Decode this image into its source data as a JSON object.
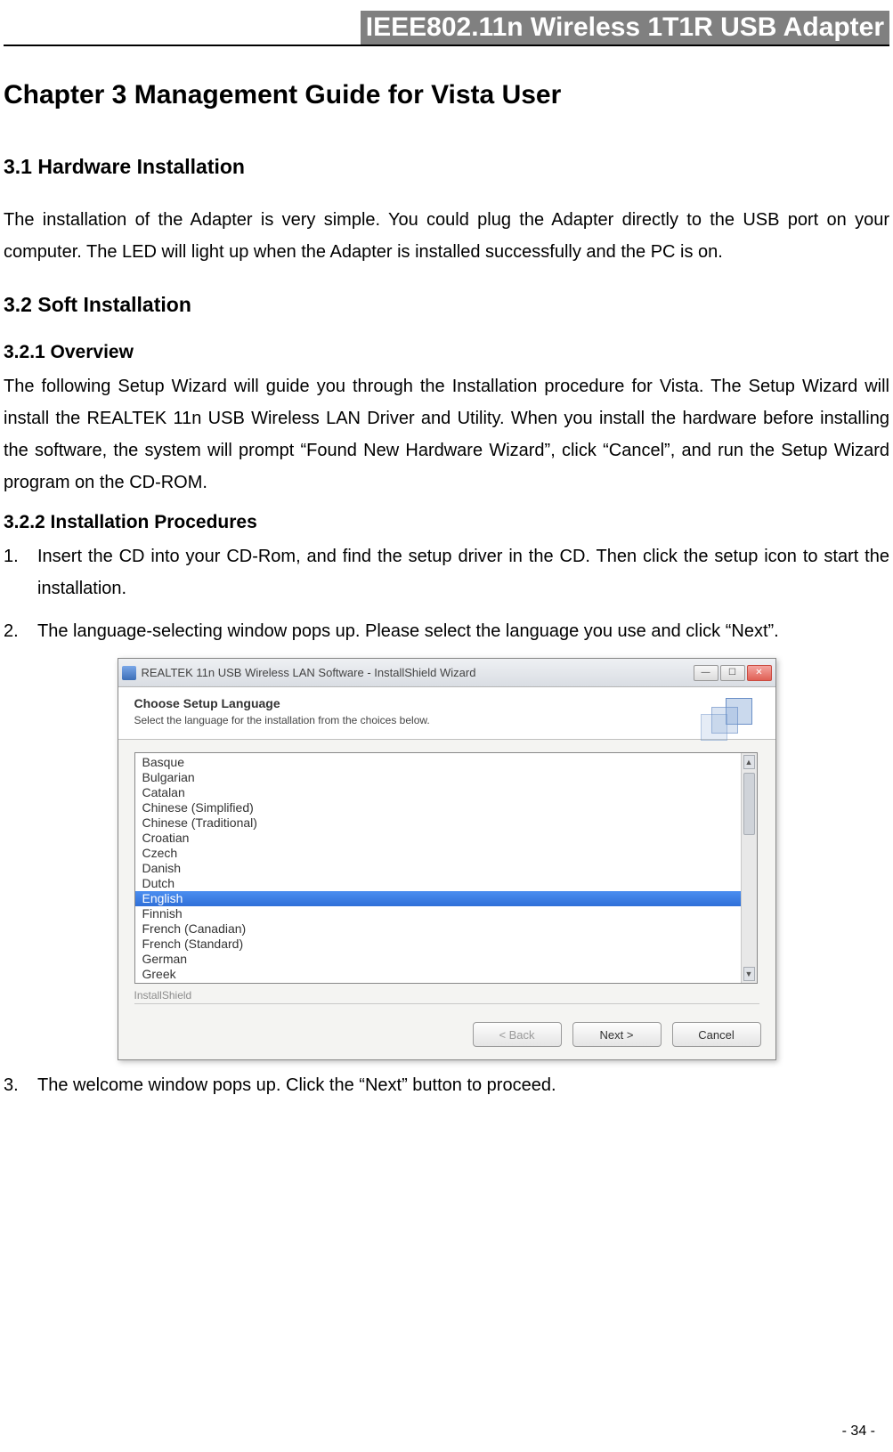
{
  "header_title": "IEEE802.11n Wireless 1T1R USB Adapter",
  "chapter_title": "Chapter 3   Management Guide for Vista User",
  "section_3_1_title": "3.1    Hardware Installation",
  "section_3_1_body": "The installation of the Adapter is very simple. You could plug the Adapter directly to the USB port on your computer. The LED will light up when the Adapter is installed successfully and the PC is on.",
  "section_3_2_title": "3.2    Soft Installation",
  "section_3_2_1_title": "3.2.1    Overview",
  "section_3_2_1_body": "The following Setup Wizard will guide you through the Installation procedure for Vista. The Setup Wizard will install the REALTEK 11n USB Wireless LAN Driver and Utility. When you install the hardware before installing the software, the system will prompt “Found New Hardware Wizard”, click “Cancel”, and run the Setup Wizard program on the CD-ROM.",
  "section_3_2_2_title": "3.2.2    Installation Procedures",
  "steps": {
    "s1": "Insert the CD into your CD-Rom, and find the setup driver in the CD. Then click the setup icon to start the installation.",
    "s2": "The language-selecting window pops up. Please select the language you use and click “Next”.",
    "s3": "The welcome window pops up. Click the “Next” button to proceed."
  },
  "dialog": {
    "title": "REALTEK 11n USB Wireless LAN Software - InstallShield Wizard",
    "heading": "Choose Setup Language",
    "subheading": "Select the language for the installation from the choices below.",
    "languages": [
      "Basque",
      "Bulgarian",
      "Catalan",
      "Chinese (Simplified)",
      "Chinese (Traditional)",
      "Croatian",
      "Czech",
      "Danish",
      "Dutch",
      "English",
      "Finnish",
      "French (Canadian)",
      "French (Standard)",
      "German",
      "Greek"
    ],
    "selected": "English",
    "brand": "InstallShield",
    "buttons": {
      "back": "< Back",
      "next": "Next >",
      "cancel": "Cancel"
    }
  },
  "page_number": "- 34 -"
}
